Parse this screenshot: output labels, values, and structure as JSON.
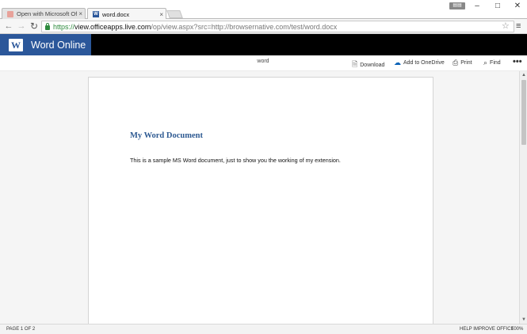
{
  "browser": {
    "tabs": [
      {
        "title": "Open with Microsoft Office",
        "close": "×",
        "favicon_letter": ""
      },
      {
        "title": "word.docx",
        "close": "×",
        "favicon_letter": "W"
      }
    ],
    "window_badge": "▤▤",
    "window_controls": {
      "minimize": "–",
      "maximize": "□",
      "close": "✕"
    },
    "nav": {
      "back": "←",
      "forward": "→",
      "reload": "↻"
    },
    "url": {
      "scheme": "https://",
      "host": "view.officeapps.live.com",
      "path": "/op/view.aspx?src=http://browsernative.com/test/word.docx"
    },
    "star": "☆",
    "menu": "≡"
  },
  "app": {
    "logo_letter": "W",
    "name": "Word Online",
    "brand_color": "#2b579a"
  },
  "commandbar": {
    "doc_name": "word",
    "download": "Download",
    "onedrive": "Add to OneDrive",
    "print": "Print",
    "find": "Find",
    "more": "•••"
  },
  "document": {
    "title": "My Word Document",
    "body": "This is a sample MS Word document, just to show you the working of my extension."
  },
  "status": {
    "page": "PAGE 1 OF 2",
    "help": "HELP IMPROVE OFFICE",
    "zoom": "100%"
  }
}
